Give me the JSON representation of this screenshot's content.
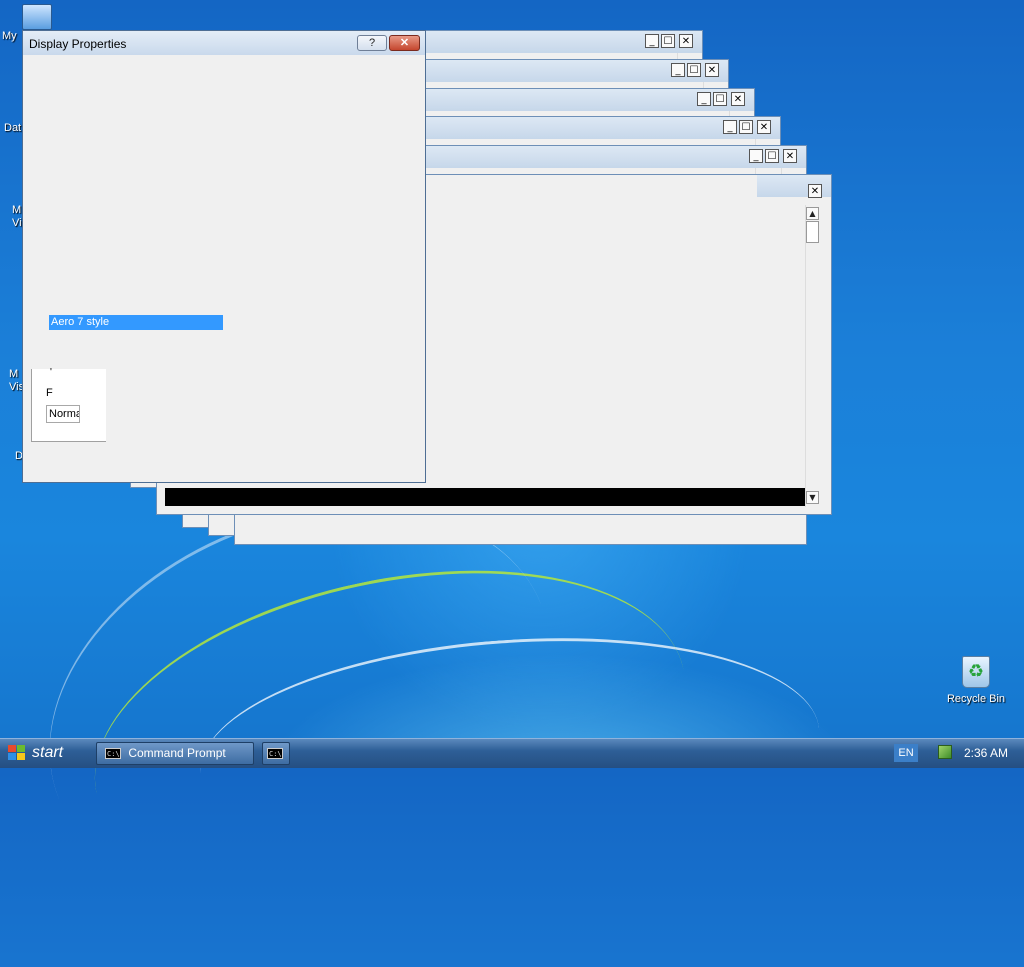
{
  "desktop": {
    "icons": [
      {
        "label": "My",
        "icon": "computer-icon"
      },
      {
        "label": "Dat",
        "icon": "folder-icon"
      },
      {
        "label": "M\nVi",
        "icon": "app-icon"
      },
      {
        "label": "M\nVis",
        "icon": "app-icon"
      },
      {
        "label": "D",
        "icon": "app-icon"
      }
    ],
    "recycle_bin": {
      "label": "Recycle Bin",
      "icon": "recycle-bin-icon"
    }
  },
  "windows": {
    "controls": {
      "minimize": "_",
      "maximize": "☐",
      "close": "✕"
    },
    "scroll_up": "▲",
    "scroll_down": "▼"
  },
  "display_properties": {
    "title": "Display Properties",
    "help_label": "?",
    "close_label": "✕",
    "selected_item": "Aero 7 style",
    "fragments": {
      "f1": "'",
      "f2": "F",
      "f3": "Norma"
    }
  },
  "taskbar": {
    "start_label": "start",
    "tasks": [
      {
        "label": "Command Prompt",
        "icon": "cmd-icon"
      },
      {
        "label": "",
        "icon": "cmd-icon"
      }
    ],
    "language": "EN",
    "clock": "2:36 AM"
  },
  "colors": {
    "accent": "#3399ff",
    "desktop": "#1a7fd8",
    "close_red": "#c4462e"
  }
}
